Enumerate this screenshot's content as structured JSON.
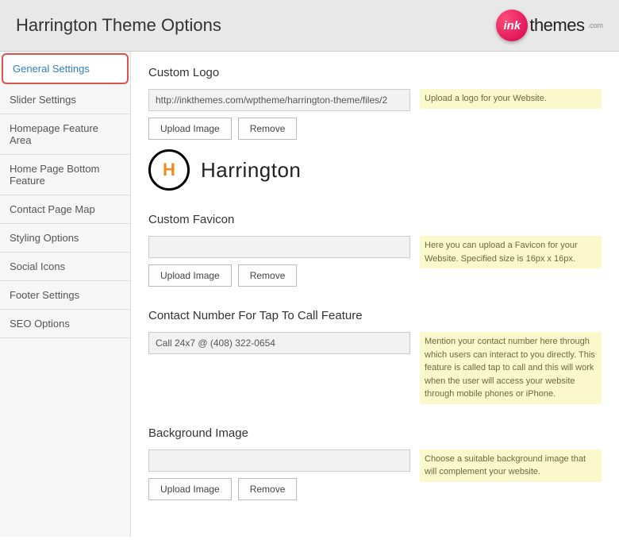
{
  "header": {
    "title": "Harrington Theme Options",
    "brand_ball": "ink",
    "brand_text": "themes",
    "brand_sub": ".com"
  },
  "sidebar": {
    "items": [
      {
        "label": "General Settings"
      },
      {
        "label": "Slider Settings"
      },
      {
        "label": "Homepage Feature Area"
      },
      {
        "label": "Home Page Bottom Feature"
      },
      {
        "label": "Contact Page Map"
      },
      {
        "label": "Styling Options"
      },
      {
        "label": "Social Icons"
      },
      {
        "label": "Footer Settings"
      },
      {
        "label": "SEO Options"
      }
    ]
  },
  "sections": {
    "custom_logo": {
      "title": "Custom Logo",
      "value": "http://inkthemes.com/wptheme/harrington-theme/files/2",
      "upload": "Upload Image",
      "remove": "Remove",
      "help": "Upload a logo for your Website.",
      "preview_letter": "H",
      "preview_name": "Harrington"
    },
    "custom_favicon": {
      "title": "Custom Favicon",
      "value": "",
      "upload": "Upload Image",
      "remove": "Remove",
      "help": "Here you can upload a Favicon for your Website. Specified size is 16px x 16px."
    },
    "contact_number": {
      "title": "Contact Number For Tap To Call Feature",
      "value": "Call 24x7 @ (408) 322-0654",
      "help": "Mention your contact number here through which users can interact to you directly. This feature is called tap to call and this will work when the user will access your website through mobile phones or iPhone."
    },
    "background_image": {
      "title": "Background Image",
      "value": "",
      "upload": "Upload Image",
      "remove": "Remove",
      "help": "Choose a suitable background image that will complement your website."
    }
  }
}
